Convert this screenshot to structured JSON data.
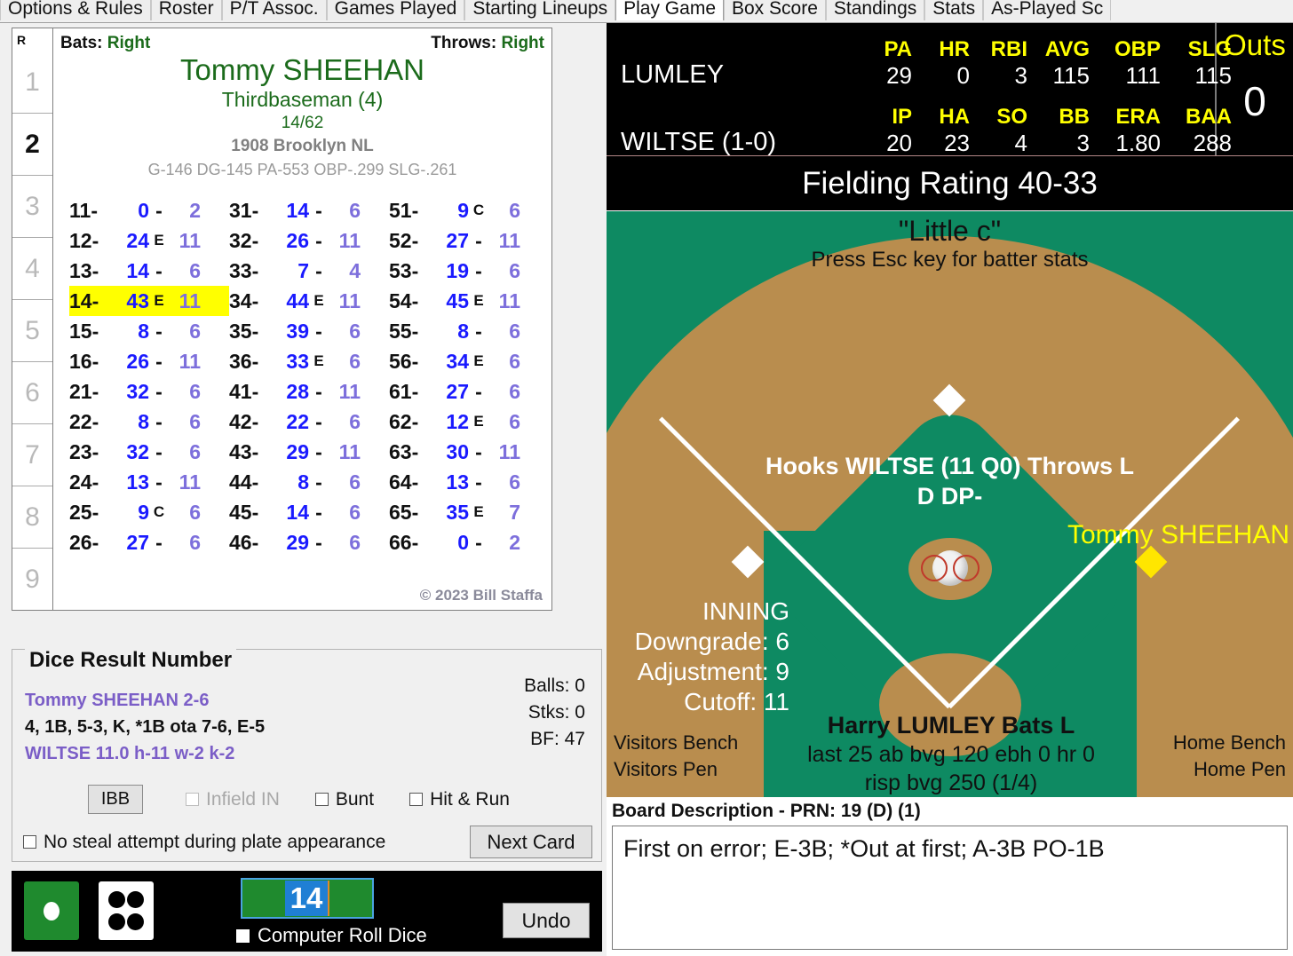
{
  "tabs": [
    {
      "label": "Options & Rules",
      "active": false
    },
    {
      "label": "Roster",
      "active": false
    },
    {
      "label": "P/T Assoc.",
      "active": false
    },
    {
      "label": "Games Played",
      "active": false
    },
    {
      "label": "Starting Lineups",
      "active": false
    },
    {
      "label": "Play Game",
      "active": true
    },
    {
      "label": "Box Score",
      "active": false
    },
    {
      "label": "Standings",
      "active": false
    },
    {
      "label": "Stats",
      "active": false
    },
    {
      "label": "As-Played Sc",
      "active": false
    }
  ],
  "batting_order": {
    "header": "R",
    "slots": [
      "1",
      "2",
      "3",
      "4",
      "5",
      "6",
      "7",
      "8",
      "9"
    ],
    "selected": "2"
  },
  "player_card": {
    "bats_label": "Bats:",
    "bats_value": "Right",
    "throws_label": "Throws:",
    "throws_value": "Right",
    "name": "Tommy SHEEHAN",
    "position": "Thirdbaseman (4)",
    "fraction": "14/62",
    "team": "1908 Brooklyn NL",
    "stats_line": "G-146 DG-145 PA-553 OBP-.299 SLG-.261",
    "copyright": "© 2023 Bill Staffa",
    "results": [
      {
        "key": "11-",
        "value": "0",
        "sep": "-",
        "num": "2",
        "hl": false
      },
      {
        "key": "12-",
        "value": "24",
        "sep": "E",
        "num": "11",
        "hl": false
      },
      {
        "key": "13-",
        "value": "14",
        "sep": "-",
        "num": "6",
        "hl": false
      },
      {
        "key": "14-",
        "value": "43",
        "sep": "E",
        "num": "11",
        "hl": true
      },
      {
        "key": "15-",
        "value": "8",
        "sep": "-",
        "num": "6",
        "hl": false
      },
      {
        "key": "16-",
        "value": "26",
        "sep": "-",
        "num": "11",
        "hl": false
      },
      {
        "key": "21-",
        "value": "32",
        "sep": "-",
        "num": "6",
        "hl": false
      },
      {
        "key": "22-",
        "value": "8",
        "sep": "-",
        "num": "6",
        "hl": false
      },
      {
        "key": "23-",
        "value": "32",
        "sep": "-",
        "num": "6",
        "hl": false
      },
      {
        "key": "24-",
        "value": "13",
        "sep": "-",
        "num": "11",
        "hl": false
      },
      {
        "key": "25-",
        "value": "9",
        "sep": "C",
        "num": "6",
        "hl": false
      },
      {
        "key": "26-",
        "value": "27",
        "sep": "-",
        "num": "6",
        "hl": false
      },
      {
        "key": "31-",
        "value": "14",
        "sep": "-",
        "num": "6",
        "hl": false
      },
      {
        "key": "32-",
        "value": "26",
        "sep": "-",
        "num": "11",
        "hl": false
      },
      {
        "key": "33-",
        "value": "7",
        "sep": "-",
        "num": "4",
        "hl": false
      },
      {
        "key": "34-",
        "value": "44",
        "sep": "E",
        "num": "11",
        "hl": false
      },
      {
        "key": "35-",
        "value": "39",
        "sep": "-",
        "num": "6",
        "hl": false
      },
      {
        "key": "36-",
        "value": "33",
        "sep": "E",
        "num": "6",
        "hl": false
      },
      {
        "key": "41-",
        "value": "28",
        "sep": "-",
        "num": "11",
        "hl": false
      },
      {
        "key": "42-",
        "value": "22",
        "sep": "-",
        "num": "6",
        "hl": false
      },
      {
        "key": "43-",
        "value": "29",
        "sep": "-",
        "num": "11",
        "hl": false
      },
      {
        "key": "44-",
        "value": "8",
        "sep": "-",
        "num": "6",
        "hl": false
      },
      {
        "key": "45-",
        "value": "14",
        "sep": "-",
        "num": "6",
        "hl": false
      },
      {
        "key": "46-",
        "value": "29",
        "sep": "-",
        "num": "6",
        "hl": false
      },
      {
        "key": "51-",
        "value": "9",
        "sep": "C",
        "num": "6",
        "hl": false
      },
      {
        "key": "52-",
        "value": "27",
        "sep": "-",
        "num": "11",
        "hl": false
      },
      {
        "key": "53-",
        "value": "19",
        "sep": "-",
        "num": "6",
        "hl": false
      },
      {
        "key": "54-",
        "value": "45",
        "sep": "E",
        "num": "11",
        "hl": false
      },
      {
        "key": "55-",
        "value": "8",
        "sep": "-",
        "num": "6",
        "hl": false
      },
      {
        "key": "56-",
        "value": "34",
        "sep": "E",
        "num": "6",
        "hl": false
      },
      {
        "key": "61-",
        "value": "27",
        "sep": "-",
        "num": "6",
        "hl": false
      },
      {
        "key": "62-",
        "value": "12",
        "sep": "E",
        "num": "6",
        "hl": false
      },
      {
        "key": "63-",
        "value": "30",
        "sep": "-",
        "num": "11",
        "hl": false
      },
      {
        "key": "64-",
        "value": "13",
        "sep": "-",
        "num": "6",
        "hl": false
      },
      {
        "key": "65-",
        "value": "35",
        "sep": "E",
        "num": "7",
        "hl": false
      },
      {
        "key": "66-",
        "value": "0",
        "sep": "-",
        "num": "2",
        "hl": false
      }
    ]
  },
  "dice_result": {
    "title": "Dice Result Number",
    "line1": "Tommy SHEEHAN  2-6",
    "line2": "4, 1B, 5-3, K, *1B ota 7-6, E-5",
    "line3": "WILTSE  11.0  h-11  w-2  k-2",
    "balls": "Balls: 0",
    "strikes": "Stks: 0",
    "bf": "BF: 47",
    "ibb_label": "IBB",
    "infield_in_label": "Infield IN",
    "bunt_label": "Bunt",
    "hit_run_label": "Hit & Run",
    "no_steal_label": "No steal attempt during plate appearance",
    "next_card_label": "Next Card"
  },
  "dice_strip": {
    "die1_value": "1",
    "die2_value": "4",
    "result_number": "14",
    "computer_roll_label": "Computer Roll Dice",
    "undo_label": "Undo"
  },
  "scoreboard": {
    "batter_name": "LUMLEY",
    "batter_headers": [
      "PA",
      "HR",
      "RBI",
      "AVG",
      "OBP",
      "SLG"
    ],
    "batter_values": [
      "29",
      "0",
      "3",
      "115",
      "111",
      "115"
    ],
    "pitcher_name": "WILTSE (1-0)",
    "pitcher_headers": [
      "IP",
      "HA",
      "SO",
      "BB",
      "ERA",
      "BAA"
    ],
    "pitcher_values": [
      "20",
      "23",
      "4",
      "3",
      "1.80",
      "288"
    ],
    "outs_label": "Outs",
    "outs_value": "0"
  },
  "fielding_rating": "Fielding Rating 40-33",
  "field": {
    "top_line1": "\"Little c\"",
    "top_line2": "Press Esc key for batter stats",
    "pitcher_line1": "Hooks WILTSE (11 Q0) Throws L",
    "pitcher_line2": "D DP-",
    "runner_label": "Tommy SHEEHAN",
    "inning_label": "INNING",
    "downgrade": "Downgrade: 6",
    "adjustment": "Adjustment: 9",
    "cutoff": "Cutoff: 11",
    "visitors_bench": "Visitors Bench",
    "visitors_pen": "Visitors Pen",
    "home_bench": "Home Bench",
    "home_pen": "Home Pen",
    "batter_line1": "Harry LUMLEY Bats L",
    "batter_line2": "last 25 ab bvg 120 ebh 0 hr 0",
    "batter_line3": "risp bvg 250 (1/4)"
  },
  "board_description": {
    "label": "Board Description - PRN: 19 (D) (1)",
    "text": "First on error; E-3B; *Out at first; A-3B PO-1B"
  },
  "colors": {
    "grass": "#0e8a62",
    "dirt": "#b98d4e",
    "highlight": "#ffff00",
    "accent_blue": "#1a1aff",
    "purple": "#7b5ec7",
    "green_text": "#1b6b1b"
  }
}
